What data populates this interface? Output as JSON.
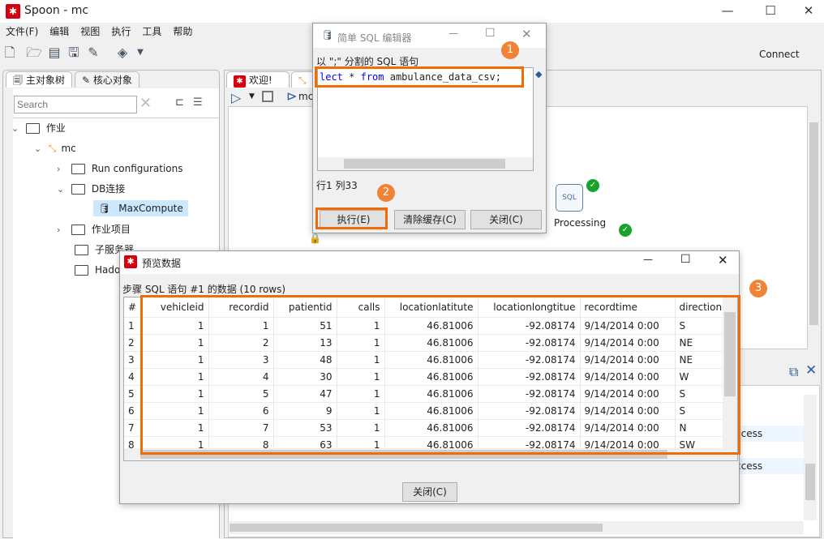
{
  "window": {
    "title": "Spoon - mc",
    "minimize": "—",
    "maximize": "☐",
    "close": "✕"
  },
  "menu": [
    "文件(F)",
    "编辑",
    "视图",
    "执行",
    "工具",
    "帮助"
  ],
  "toolbar": {
    "connect": "Connect"
  },
  "left_panel": {
    "tabs": [
      "主对象树",
      "核心对象"
    ],
    "search_placeholder": "Search",
    "tree": [
      {
        "label": "作业"
      },
      {
        "label": "mc"
      },
      {
        "label": "Run configurations"
      },
      {
        "label": "DB连接"
      },
      {
        "label": "MaxCompute"
      },
      {
        "label": "作业项目"
      },
      {
        "label": "子服务器"
      },
      {
        "label": "Hadoop"
      }
    ]
  },
  "editor_tabs": [
    "欢迎!",
    "mc"
  ],
  "canvas": {
    "step_label": "Processing",
    "log_text": [
      "ccess",
      "ccess"
    ]
  },
  "sql_editor": {
    "title": "简单 SQL 编辑器",
    "label": "以 \";\" 分割的 SQL 语句",
    "sql_keyword1": "lect",
    "sql_mid": " * ",
    "sql_keyword2": "from",
    "sql_rest": " ambulance_data_csv;",
    "cursor_pos": "行1 列33",
    "execute": "执行(E)",
    "clear_cache": "清除缓存(C)",
    "close": "关闭(C)"
  },
  "preview": {
    "title": "预览数据",
    "subtitle": "步骤 SQL 语句 #1 的数据  (10 rows)",
    "close": "关闭(C)",
    "columns": [
      "#",
      "vehicleid",
      "recordid",
      "patientid",
      "calls",
      "locationlatitute",
      "locationlongtitue",
      "recordtime",
      "direction"
    ],
    "rows": [
      [
        "1",
        "1",
        "1",
        "51",
        "1",
        "46.81006",
        "-92.08174",
        "9/14/2014 0:00",
        "S"
      ],
      [
        "2",
        "1",
        "2",
        "13",
        "1",
        "46.81006",
        "-92.08174",
        "9/14/2014 0:00",
        "NE"
      ],
      [
        "3",
        "1",
        "3",
        "48",
        "1",
        "46.81006",
        "-92.08174",
        "9/14/2014 0:00",
        "NE"
      ],
      [
        "4",
        "1",
        "4",
        "30",
        "1",
        "46.81006",
        "-92.08174",
        "9/14/2014 0:00",
        "W"
      ],
      [
        "5",
        "1",
        "5",
        "47",
        "1",
        "46.81006",
        "-92.08174",
        "9/14/2014 0:00",
        "S"
      ],
      [
        "6",
        "1",
        "6",
        "9",
        "1",
        "46.81006",
        "-92.08174",
        "9/14/2014 0:00",
        "S"
      ],
      [
        "7",
        "1",
        "7",
        "53",
        "1",
        "46.81006",
        "-92.08174",
        "9/14/2014 0:00",
        "N"
      ],
      [
        "8",
        "1",
        "8",
        "63",
        "1",
        "46.81006",
        "-92.08174",
        "9/14/2014 0:00",
        "SW"
      ]
    ]
  },
  "annotations": [
    "1",
    "2",
    "3"
  ],
  "colors": {
    "highlight": "#f26b07",
    "badge": "#f08335",
    "keyword": "#0000ff",
    "brand": "#d7000f"
  }
}
